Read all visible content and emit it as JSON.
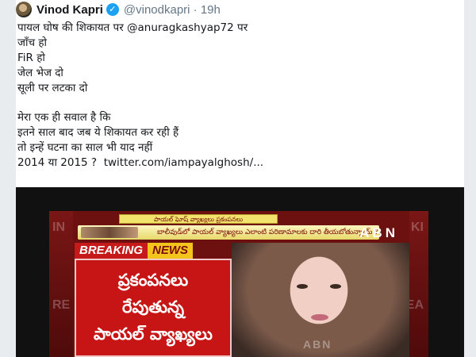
{
  "tweet": {
    "display_name": "Vinod Kapri",
    "verified_icon": "verified-badge-icon",
    "handle_time": "@vinodkapri · 19h",
    "body_lines": [
      "पायल घोष की शिकायत पर @anuragkashyap72 पर",
      "जाँच हो",
      "FiR हो",
      "जेल भेज दो",
      "सूली पर लटका दो"
    ],
    "body_lines_2": [
      "मेरा एक ही सवाल है कि",
      "इतने साल बाद जब ये शिकायत कर रही हैं",
      "तो इन्हें घटना का साल भी याद नहीं"
    ],
    "last_line_text": "2014 या 2015 ?",
    "link_text": "twitter.com/iampayalghosh/..."
  },
  "video": {
    "ticker_top": "పాయల్ ఘోష్ వ్యాఖ్యలు ప్రకంపనలు",
    "ticker_mid": "బాలీవుడ్‌లో పాయల్ వ్యాఖ్యలు ఎలాంటి పరిణామాలకు దారి తీయబోతున్నాయ్ ?",
    "channel_logo": "ABN",
    "breaking_label": "BREAKING",
    "news_label": "NEWS",
    "headline_lines": [
      "ప్రకంపనలు",
      "రేపుతున్న",
      "పాయల్ వ్యాఖ్యలు"
    ],
    "watermark": "ABN",
    "side_marks": {
      "left": "RE",
      "right": "EA",
      "top_left": "IN",
      "top_right": "KI"
    }
  },
  "colors": {
    "breaking_red": "#c61a1a",
    "breaking_yellow": "#f3c51c",
    "verified_blue": "#1da1f2",
    "headline_red": "#c71515"
  }
}
